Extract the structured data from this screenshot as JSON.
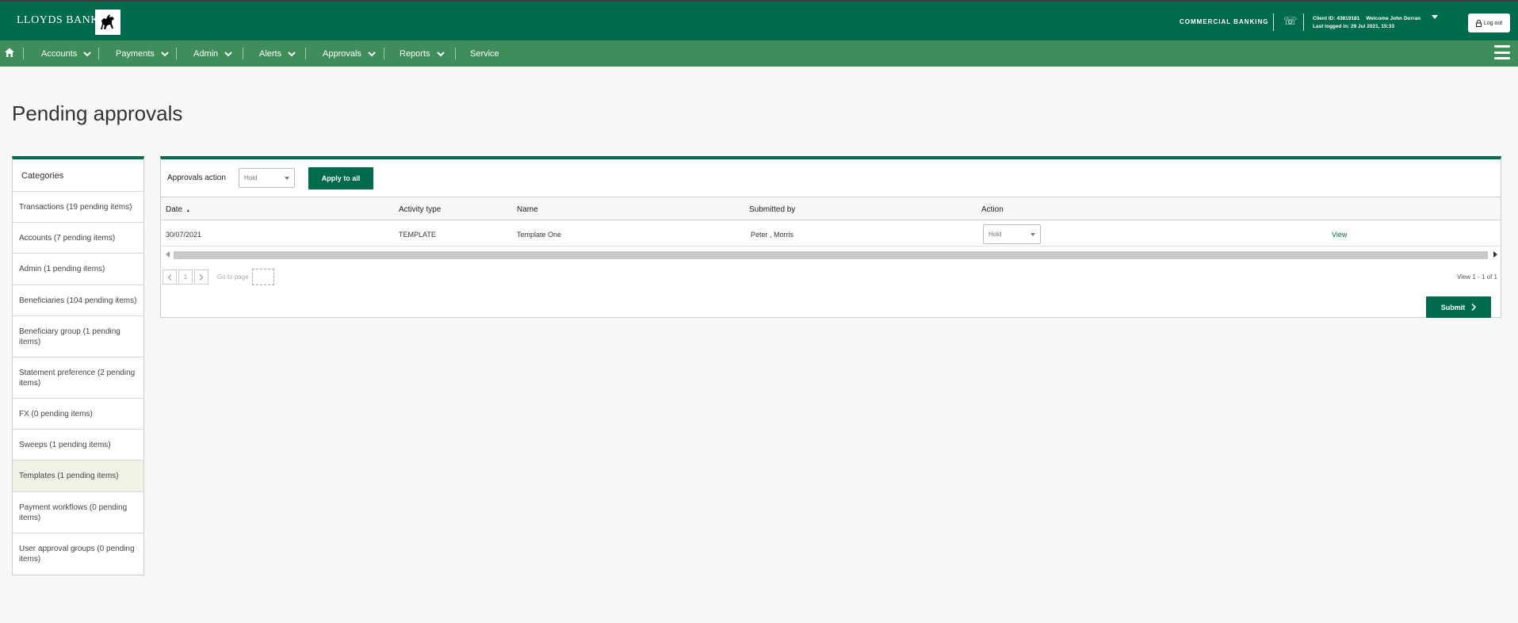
{
  "header": {
    "brand": "LLOYDS BANK",
    "logo_icon": "black-horse-logo",
    "segment": "COMMERCIAL BANKING",
    "client_id_text": "Client ID: 43819181",
    "welcome_text": "Welcome John Dorran",
    "last_logged_in": "Last logged in: 29 Jul 2021, 15:33",
    "logout_label": "Log out"
  },
  "nav": {
    "items": [
      {
        "label": "Accounts"
      },
      {
        "label": "Payments"
      },
      {
        "label": "Admin"
      },
      {
        "label": "Alerts"
      },
      {
        "label": "Approvals"
      },
      {
        "label": "Reports"
      },
      {
        "label": "Service"
      }
    ]
  },
  "page": {
    "title": "Pending approvals"
  },
  "sidebar": {
    "heading": "Categories",
    "items": [
      {
        "label": "Transactions (19 pending items)"
      },
      {
        "label": "Accounts (7 pending items)"
      },
      {
        "label": "Admin (1 pending items)"
      },
      {
        "label": "Beneficiaries (104 pending items)"
      },
      {
        "label": "Beneficiary group (1 pending items)"
      },
      {
        "label": "Statement preference (2 pending items)"
      },
      {
        "label": "FX (0 pending items)"
      },
      {
        "label": "Sweeps (1 pending items)"
      },
      {
        "label": "Templates (1 pending items)"
      },
      {
        "label": "Payment workflows (0 pending items)"
      },
      {
        "label": "User approval groups (0 pending items)"
      }
    ],
    "active_item": "Templates (1 pending items)"
  },
  "approvals": {
    "action_label": "Approvals action",
    "action_value": "Hold",
    "apply_all_label": "Apply to all",
    "columns": [
      "Date",
      "Activity type",
      "Name",
      "Submitted by",
      "Action"
    ],
    "sort_indicator": "▲",
    "rows": [
      {
        "date": "30/07/2021",
        "activity_type": "TEMPLATE",
        "name": "Template One",
        "submitted_by": "Peter , Morris",
        "action": "Hold",
        "view_label": "View"
      }
    ]
  },
  "pager": {
    "page": "1",
    "goto_label": "Go to page",
    "view_count": "View 1 - 1 of 1"
  },
  "submit_label": "Submit",
  "colors": {
    "brand_green": "#006a4d",
    "nav_green": "#3e8d5b",
    "active_category": "#eef3e6"
  }
}
